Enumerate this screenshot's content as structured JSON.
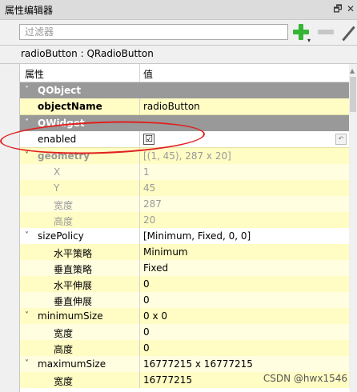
{
  "window": {
    "title": "属性编辑器",
    "float_label": "🗗",
    "close_label": "✕"
  },
  "filter": {
    "placeholder": "过滤器"
  },
  "object_label": "radioButton : QRadioButton",
  "table": {
    "header": {
      "property": "属性",
      "value": "值"
    },
    "rows": [
      {
        "type": "category",
        "name": "QObject",
        "value": ""
      },
      {
        "type": "prop",
        "name": "objectName",
        "value": "radioButton"
      },
      {
        "type": "category",
        "name": "QWidget",
        "value": ""
      },
      {
        "type": "prop",
        "name": "enabled",
        "value": "☑"
      },
      {
        "type": "prop",
        "name": "geometry",
        "value": "[(1, 45), 287 x 20]"
      },
      {
        "type": "sub",
        "name": "X",
        "value": "1"
      },
      {
        "type": "sub",
        "name": "Y",
        "value": "45"
      },
      {
        "type": "sub",
        "name": "宽度",
        "value": "287"
      },
      {
        "type": "sub",
        "name": "高度",
        "value": "20"
      },
      {
        "type": "prop",
        "name": "sizePolicy",
        "value": "[Minimum, Fixed, 0, 0]"
      },
      {
        "type": "sub",
        "name": "水平策略",
        "value": "Minimum"
      },
      {
        "type": "sub",
        "name": "垂直策略",
        "value": "Fixed"
      },
      {
        "type": "sub",
        "name": "水平伸展",
        "value": "0"
      },
      {
        "type": "sub",
        "name": "垂直伸展",
        "value": "0"
      },
      {
        "type": "prop",
        "name": "minimumSize",
        "value": "0 x 0"
      },
      {
        "type": "sub",
        "name": "宽度",
        "value": "0"
      },
      {
        "type": "sub",
        "name": "高度",
        "value": "0"
      },
      {
        "type": "prop",
        "name": "maximumSize",
        "value": "16777215 x 16777215"
      },
      {
        "type": "sub",
        "name": "宽度",
        "value": "16777215"
      }
    ]
  },
  "watermark": "CSDN @hwx1546",
  "colors": {
    "annotation_ring": "#e02020",
    "row_yellow": "#fffcc4",
    "category_bg": "#999999"
  }
}
